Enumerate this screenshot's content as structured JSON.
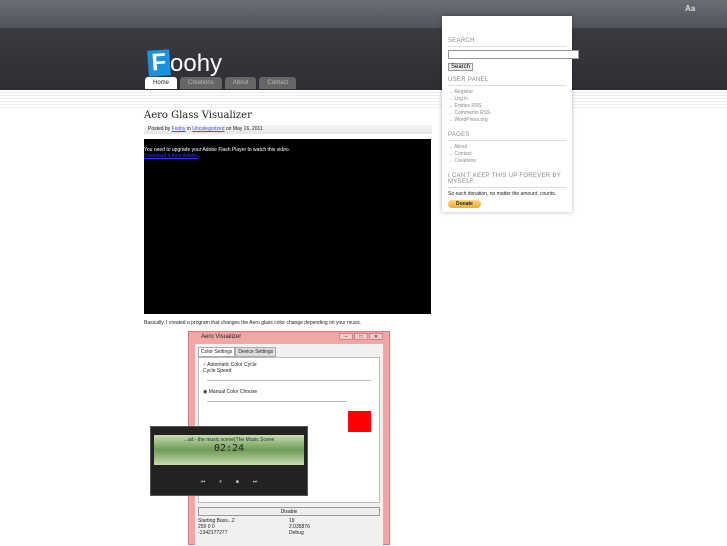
{
  "header": {
    "font_size_control": "Aa",
    "logo_letter": "F",
    "logo_rest": "oohy"
  },
  "nav": [
    "Home",
    "Creations",
    "About",
    "Contact"
  ],
  "sidebar": {
    "search_heading": "SEARCH",
    "search_button": "Search",
    "search_value": "",
    "user_panel_heading": "USER PANEL",
    "user_panel_links": [
      "Register",
      "Log in",
      "Entries RSS",
      "Comments RSS",
      "WordPress.org"
    ],
    "pages_heading": "PAGES",
    "pages_links": [
      "About",
      "Contact",
      "Creations"
    ],
    "donate_heading": "I CAN'T KEEP THIS UP FOREVER BY MYSELF.",
    "donate_text": "So each donation, no matter the amount, counts.",
    "donate_button": "Donate"
  },
  "post": {
    "title": "Aero Glass Visualizer",
    "posted_by": "Posted by",
    "author": "Foohy",
    "in": "in",
    "category": "Uncategorized",
    "date": "on May 16, 2011",
    "flash_msg": "You need to upgrade your Adobe Flash Player to watch this video.",
    "flash_link": "Download it from Adobe.",
    "body": "Basically, I created a program that changes the Aero glass color change depending on your music."
  },
  "app": {
    "title": "Aero Visualizer",
    "tabs": [
      "Color Settings",
      "Device Settings"
    ],
    "auto": "Automatic Color Cycle",
    "cycle_speed": "Cycle Speed",
    "manual": "Manual Color Choose",
    "swatch_color": "#ff0000",
    "disable": "Disable",
    "stats": [
      "Starting Bass...2",
      "19",
      "255 0 0",
      "2.035876",
      "-1342177277",
      "Debug"
    ]
  },
  "player": {
    "track": "...ad - the music scene(The Music Scene",
    "time": "02:24"
  }
}
